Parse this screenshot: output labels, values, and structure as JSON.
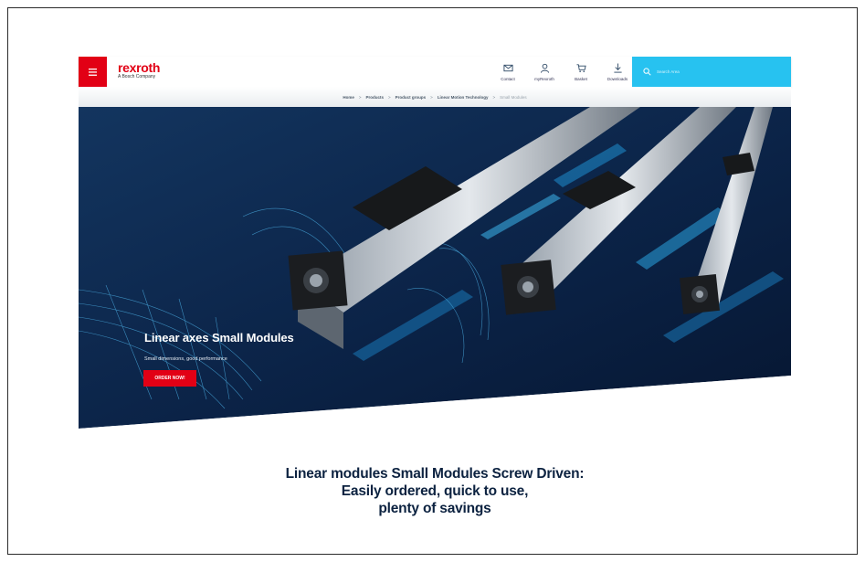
{
  "header": {
    "menu_icon": "hamburger-menu-icon",
    "logo": {
      "brand": "rexroth",
      "sub": "A Bosch Company"
    },
    "nav": [
      {
        "label": "Contact",
        "icon": "mail-icon"
      },
      {
        "label": "myRexroth",
        "icon": "user-icon"
      },
      {
        "label": "Basket",
        "icon": "basket-icon"
      },
      {
        "label": "Downloads",
        "icon": "download-icon"
      }
    ],
    "search": {
      "placeholder": "Search Area",
      "icon": "search-icon"
    }
  },
  "breadcrumb": [
    "Home",
    "Products",
    "Product groups",
    "Linear Motion Technology",
    "Small Modules"
  ],
  "hero": {
    "title": "Linear axes Small Modules",
    "subtitle": "Small dimensions, good performance",
    "cta": "ORDER NOW!"
  },
  "headline": {
    "line1": "Linear modules Small Modules Screw Driven:",
    "line2": "Easily ordered, quick to use,",
    "line3": "plenty of savings"
  },
  "colors": {
    "brand_red": "#e20015",
    "search_blue": "#27c2f0",
    "hero_navy": "#0b2347",
    "headline_navy": "#0c2240"
  }
}
